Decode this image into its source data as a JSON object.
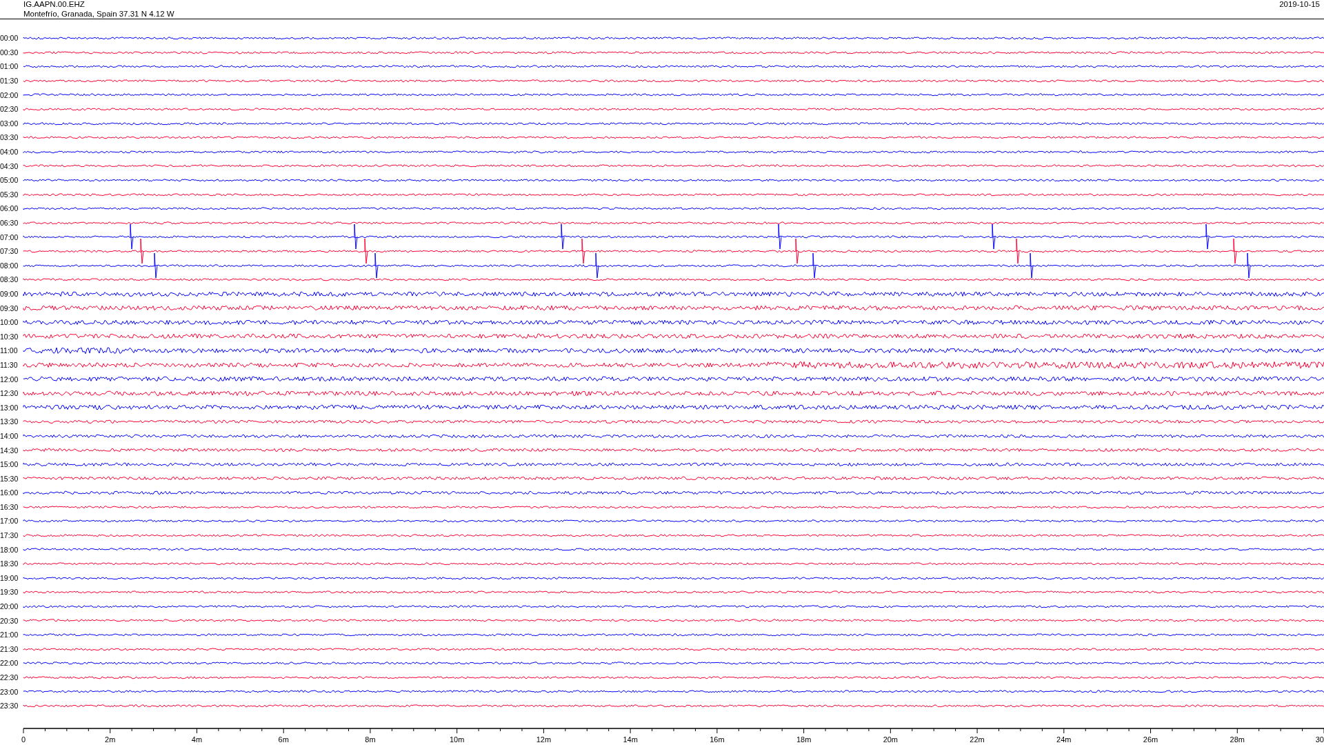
{
  "header": {
    "station": "IG.AAPN.00.EHZ",
    "location": "Montefrío, Granada, Spain  37.31 N 4.12 W",
    "date": "2019-10-15"
  },
  "rows": [
    {
      "label": "00:00",
      "color": "#0000ff"
    },
    {
      "label": "00:30",
      "color": "#ff0033"
    },
    {
      "label": "01:00",
      "color": "#0000ff"
    },
    {
      "label": "01:30",
      "color": "#ff0033"
    },
    {
      "label": "02:00",
      "color": "#0000ff"
    },
    {
      "label": "02:30",
      "color": "#ff0033"
    },
    {
      "label": "03:00",
      "color": "#0000ff"
    },
    {
      "label": "03:30",
      "color": "#ff0033"
    },
    {
      "label": "04:00",
      "color": "#0000ff"
    },
    {
      "label": "04:30",
      "color": "#ff0033"
    },
    {
      "label": "05:00",
      "color": "#0000ff"
    },
    {
      "label": "05:30",
      "color": "#ff0033"
    },
    {
      "label": "06:00",
      "color": "#0000ff"
    },
    {
      "label": "06:30",
      "color": "#ff0033"
    },
    {
      "label": "07:00",
      "color": "#0000ff"
    },
    {
      "label": "07:30",
      "color": "#ff0033"
    },
    {
      "label": "08:00",
      "color": "#0000ff"
    },
    {
      "label": "08:30",
      "color": "#ff0033"
    },
    {
      "label": "09:00",
      "color": "#0000ff"
    },
    {
      "label": "09:30",
      "color": "#ff0033"
    },
    {
      "label": "10:00",
      "color": "#0000ff"
    },
    {
      "label": "10:30",
      "color": "#ff0033"
    },
    {
      "label": "11:00",
      "color": "#0000ff"
    },
    {
      "label": "11:30",
      "color": "#ff0033"
    },
    {
      "label": "12:00",
      "color": "#0000ff"
    },
    {
      "label": "12:30",
      "color": "#ff0033"
    },
    {
      "label": "13:00",
      "color": "#0000ff"
    },
    {
      "label": "13:30",
      "color": "#ff0033"
    },
    {
      "label": "14:00",
      "color": "#0000ff"
    },
    {
      "label": "14:30",
      "color": "#ff0033"
    },
    {
      "label": "15:00",
      "color": "#0000ff"
    },
    {
      "label": "15:30",
      "color": "#ff0033"
    },
    {
      "label": "16:00",
      "color": "#0000ff"
    },
    {
      "label": "16:30",
      "color": "#ff0033"
    },
    {
      "label": "17:00",
      "color": "#0000ff"
    },
    {
      "label": "17:30",
      "color": "#ff0033"
    },
    {
      "label": "18:00",
      "color": "#0000ff"
    },
    {
      "label": "18:30",
      "color": "#ff0033"
    },
    {
      "label": "19:00",
      "color": "#0000ff"
    },
    {
      "label": "19:30",
      "color": "#ff0033"
    },
    {
      "label": "20:00",
      "color": "#0000ff"
    },
    {
      "label": "20:30",
      "color": "#ff0033"
    },
    {
      "label": "21:00",
      "color": "#0000ff"
    },
    {
      "label": "21:30",
      "color": "#ff0033"
    },
    {
      "label": "22:00",
      "color": "#0000ff"
    },
    {
      "label": "22:30",
      "color": "#ff0033"
    },
    {
      "label": "23:00",
      "color": "#0000ff"
    },
    {
      "label": "23:30",
      "color": "#ff0033"
    }
  ],
  "axis": {
    "ticks": [
      "0",
      "2m",
      "4m",
      "6m",
      "8m",
      "10m",
      "12m",
      "14m",
      "16m",
      "18m",
      "20m",
      "22m",
      "24m",
      "26m",
      "28m",
      "30"
    ]
  }
}
